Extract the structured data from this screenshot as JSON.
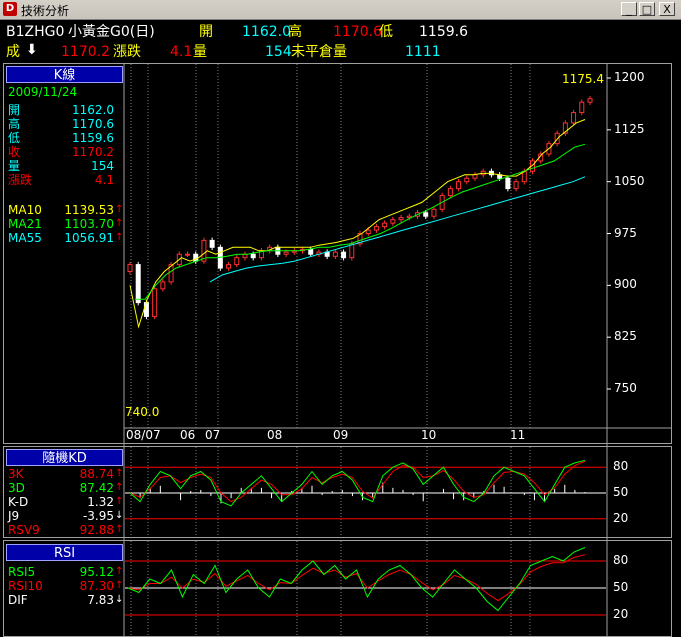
{
  "window": {
    "title": "技術分析",
    "min": "_",
    "max": "□",
    "close": "X"
  },
  "quote": {
    "symbol": "B1ZHG0",
    "name": "小黃金G0(日)",
    "open_label": "開",
    "open": "1162.0",
    "high_label": "高",
    "high": "1170.6",
    "low_label": "低",
    "low": "1159.6",
    "close_label": "成",
    "close": "1170.2",
    "change_label": "漲跌",
    "change": "4.1",
    "volume_label": "量",
    "volume": "154",
    "oi_label": "未平倉量",
    "oi": "1111"
  },
  "kline": {
    "header": "K線",
    "date": "2009/11/24",
    "rows": [
      {
        "label": "開",
        "value": "1162.0",
        "color": "#00ffff"
      },
      {
        "label": "高",
        "value": "1170.6",
        "color": "#00ffff"
      },
      {
        "label": "低",
        "value": "1159.6",
        "color": "#00ffff"
      },
      {
        "label": "收",
        "value": "1170.2",
        "color": "#ff0000"
      },
      {
        "label": "量",
        "value": "154",
        "color": "#00ffff"
      },
      {
        "label": "漲跌",
        "value": "4.1",
        "color": "#ff0000"
      }
    ],
    "ma": [
      {
        "label": "MA10",
        "value": "1139.53",
        "color": "#ffff00"
      },
      {
        "label": "MA21",
        "value": "1103.70",
        "color": "#00ff00"
      },
      {
        "label": "MA55",
        "value": "1056.91",
        "color": "#00ffff"
      }
    ]
  },
  "kd": {
    "header": "隨機KD",
    "rows": [
      {
        "label": "3K",
        "value": "88.74",
        "color": "#ff0000",
        "arrow": "up"
      },
      {
        "label": "3D",
        "value": "87.42",
        "color": "#00ff00",
        "arrow": "up"
      },
      {
        "label": "K-D",
        "value": "1.32",
        "color": "#ffffff",
        "arrow": "up"
      },
      {
        "label": "J9",
        "value": "-3.95",
        "color": "#ffffff",
        "arrow": "down"
      },
      {
        "label": "RSV9",
        "value": "92.88",
        "color": "#ff0000",
        "arrow": "up"
      }
    ],
    "ticks": [
      "80",
      "50",
      "20"
    ]
  },
  "rsi": {
    "header": "RSI",
    "rows": [
      {
        "label": "RSI5",
        "value": "95.12",
        "color": "#00ff00",
        "arrow": "up"
      },
      {
        "label": "RSI10",
        "value": "87.30",
        "color": "#ff0000",
        "arrow": "up"
      },
      {
        "label": "DIF",
        "value": "7.83",
        "color": "#ffffff",
        "arrow": "down"
      }
    ],
    "ticks": [
      "80",
      "50",
      "20"
    ]
  },
  "chart_data": {
    "type": "candlestick",
    "y_ticks": [
      "1200",
      "1125",
      "1050",
      "975",
      "900",
      "825",
      "750"
    ],
    "ylim": [
      740,
      1200
    ],
    "x_labels": [
      "08/07",
      "06",
      "07",
      "08",
      "09",
      "10",
      "11"
    ],
    "max_label": "1175.4",
    "min_label": "740.0",
    "closes": [
      930,
      875,
      855,
      895,
      905,
      930,
      945,
      945,
      935,
      965,
      955,
      925,
      930,
      940,
      945,
      940,
      950,
      955,
      945,
      948,
      950,
      952,
      945,
      948,
      942,
      948,
      940,
      960,
      975,
      980,
      985,
      990,
      995,
      998,
      1000,
      1005,
      1000,
      1010,
      1030,
      1040,
      1050,
      1055,
      1060,
      1065,
      1060,
      1055,
      1040,
      1050,
      1065,
      1080,
      1090,
      1105,
      1120,
      1135,
      1150,
      1165,
      1170
    ],
    "ma10": [
      900,
      840,
      880,
      905,
      920,
      930,
      940,
      935,
      940,
      950,
      945,
      950,
      955,
      955,
      955,
      950,
      950,
      955,
      955,
      955,
      955,
      955,
      958,
      960,
      962,
      965,
      968,
      975,
      985,
      995,
      1000,
      1005,
      1010,
      1015,
      1020,
      1030,
      1040,
      1050,
      1055,
      1060,
      1060,
      1062,
      1062,
      1060,
      1058,
      1058,
      1065,
      1075,
      1090,
      1100,
      1115,
      1125,
      1135,
      1140
    ],
    "ma21": [
      880,
      880,
      900,
      915,
      925,
      930,
      935,
      940,
      940,
      942,
      945,
      945,
      948,
      950,
      950,
      950,
      950,
      952,
      955,
      955,
      958,
      960,
      965,
      970,
      975,
      982,
      990,
      998,
      1005,
      1012,
      1020,
      1028,
      1035,
      1040,
      1045,
      1050,
      1055,
      1060,
      1065,
      1070,
      1075,
      1080,
      1090,
      1100,
      1104
    ],
    "ma55": [
      905,
      915,
      920,
      925,
      928,
      930,
      932,
      935,
      940,
      945,
      950,
      955,
      960,
      965,
      970,
      975,
      980,
      985,
      990,
      995,
      1000,
      1005,
      1010,
      1015,
      1020,
      1025,
      1030,
      1035,
      1040,
      1045,
      1050,
      1057
    ],
    "kd_k": [
      50,
      40,
      60,
      75,
      70,
      55,
      70,
      75,
      65,
      40,
      35,
      50,
      60,
      70,
      55,
      40,
      50,
      60,
      75,
      60,
      70,
      75,
      65,
      45,
      40,
      70,
      80,
      85,
      78,
      60,
      70,
      80,
      60,
      45,
      40,
      50,
      70,
      80,
      75,
      70,
      55,
      40,
      60,
      80,
      85,
      88
    ],
    "kd_d": [
      50,
      45,
      55,
      68,
      70,
      62,
      68,
      72,
      68,
      50,
      40,
      45,
      55,
      65,
      60,
      48,
      48,
      55,
      68,
      62,
      68,
      72,
      68,
      52,
      44,
      60,
      75,
      82,
      80,
      68,
      70,
      76,
      66,
      52,
      45,
      48,
      62,
      74,
      75,
      72,
      62,
      48,
      56,
      72,
      82,
      87
    ],
    "rsi5": [
      50,
      45,
      60,
      55,
      70,
      40,
      65,
      55,
      75,
      45,
      60,
      70,
      50,
      40,
      60,
      55,
      70,
      80,
      65,
      75,
      60,
      70,
      40,
      60,
      70,
      75,
      65,
      50,
      40,
      55,
      70,
      60,
      50,
      35,
      25,
      40,
      55,
      75,
      80,
      85,
      80,
      90,
      95
    ],
    "rsi10": [
      50,
      48,
      55,
      55,
      62,
      50,
      60,
      56,
      66,
      52,
      58,
      64,
      55,
      48,
      56,
      55,
      64,
      72,
      66,
      70,
      62,
      66,
      50,
      58,
      65,
      70,
      65,
      56,
      48,
      54,
      64,
      60,
      54,
      44,
      36,
      44,
      54,
      68,
      74,
      78,
      78,
      84,
      87
    ]
  }
}
